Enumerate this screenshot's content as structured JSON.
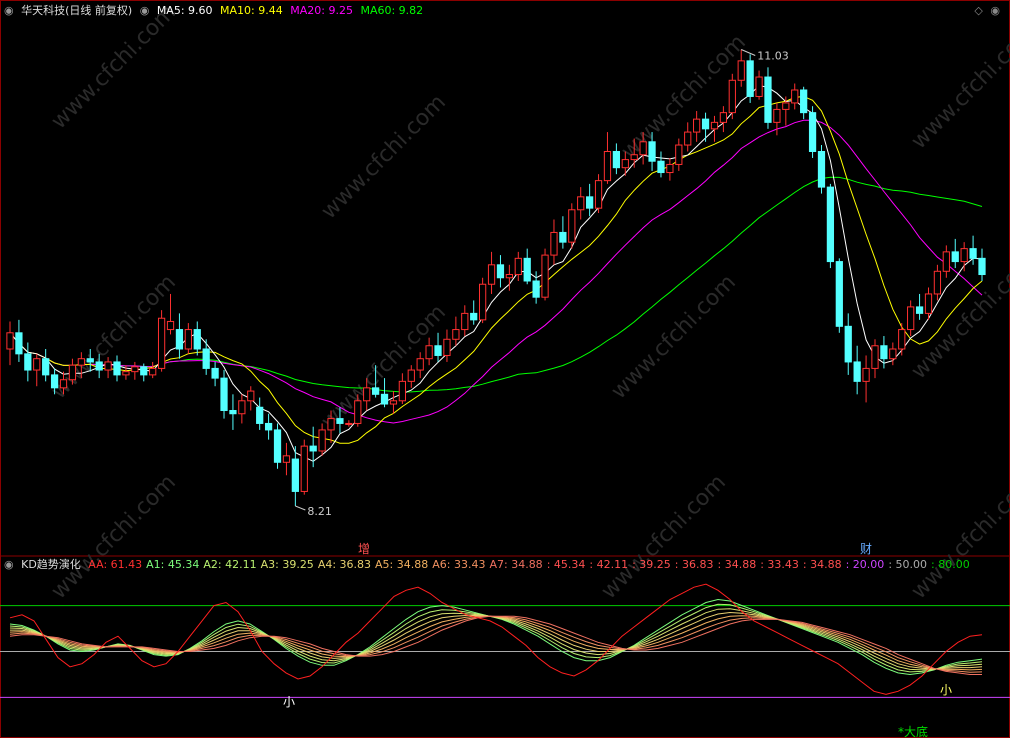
{
  "main_header": {
    "title": "华天科技(日线 前复权)",
    "items": [
      {
        "label": "MA5: 9.60",
        "color": "#ffffff"
      },
      {
        "label": "MA10: 9.44",
        "color": "#ffff00"
      },
      {
        "label": "MA20: 9.25",
        "color": "#ff00ff"
      },
      {
        "label": "MA60: 9.82",
        "color": "#00ff00"
      }
    ]
  },
  "kd_header": {
    "title": "KD趋势演化",
    "items": [
      {
        "label": "AA: 61.43",
        "color": "#ff3030"
      },
      {
        "label": "A1: 45.34",
        "color": "#7cfc7c"
      },
      {
        "label": "A2: 42.11",
        "color": "#b8f070"
      },
      {
        "label": "A3: 39.25",
        "color": "#d8e070"
      },
      {
        "label": "A4: 36.83",
        "color": "#e8d070"
      },
      {
        "label": "A5: 34.88",
        "color": "#f0b060"
      },
      {
        "label": "A6: 33.43",
        "color": "#f09060"
      },
      {
        "label": "A7: 34.88",
        "color": "#f07060"
      },
      {
        "label": ": 45.34",
        "color": "#ff5050"
      },
      {
        "label": ": 42.11",
        "color": "#ff5050"
      },
      {
        "label": ": 39.25",
        "color": "#ff5050"
      },
      {
        "label": ": 36.83",
        "color": "#ff5050"
      },
      {
        "label": ": 34.88",
        "color": "#ff5050"
      },
      {
        "label": ": 33.43",
        "color": "#ff5050"
      },
      {
        "label": ": 34.88",
        "color": "#ff5050"
      },
      {
        "label": ": 20.00",
        "color": "#cc44ff"
      },
      {
        "label": ": 50.00",
        "color": "#aaaaaa"
      },
      {
        "label": ": 80.00",
        "color": "#00cc00"
      }
    ]
  },
  "markers": {
    "high": "11.03",
    "low": "8.21",
    "event1": "增",
    "event2": "财",
    "small1": "小",
    "small2": "小",
    "bottom": "*大底"
  },
  "watermark": "www.cfchi.com",
  "colors": {
    "up": "#ff3030",
    "down": "#54ffff",
    "ma5": "#ffffff",
    "ma10": "#ffff00",
    "ma20": "#ff00ff",
    "ma60": "#00ff00"
  },
  "chart_data": {
    "type": "candlestick",
    "price_range": [
      8.0,
      11.2
    ],
    "candles": [
      {
        "o": 9.18,
        "h": 9.35,
        "l": 9.08,
        "c": 9.28
      },
      {
        "o": 9.28,
        "h": 9.36,
        "l": 9.1,
        "c": 9.15
      },
      {
        "o": 9.15,
        "h": 9.22,
        "l": 8.98,
        "c": 9.05
      },
      {
        "o": 9.05,
        "h": 9.15,
        "l": 8.95,
        "c": 9.12
      },
      {
        "o": 9.12,
        "h": 9.18,
        "l": 8.98,
        "c": 9.02
      },
      {
        "o": 9.02,
        "h": 9.06,
        "l": 8.9,
        "c": 8.94
      },
      {
        "o": 8.94,
        "h": 9.04,
        "l": 8.9,
        "c": 8.99
      },
      {
        "o": 8.99,
        "h": 9.12,
        "l": 8.96,
        "c": 9.08
      },
      {
        "o": 9.08,
        "h": 9.16,
        "l": 9.0,
        "c": 9.12
      },
      {
        "o": 9.12,
        "h": 9.18,
        "l": 9.04,
        "c": 9.1
      },
      {
        "o": 9.1,
        "h": 9.15,
        "l": 9.0,
        "c": 9.05
      },
      {
        "o": 9.05,
        "h": 9.13,
        "l": 9.0,
        "c": 9.1
      },
      {
        "o": 9.1,
        "h": 9.14,
        "l": 8.98,
        "c": 9.02
      },
      {
        "o": 9.02,
        "h": 9.08,
        "l": 8.99,
        "c": 9.04
      },
      {
        "o": 9.04,
        "h": 9.1,
        "l": 8.99,
        "c": 9.07
      },
      {
        "o": 9.07,
        "h": 9.09,
        "l": 8.98,
        "c": 9.02
      },
      {
        "o": 9.02,
        "h": 9.1,
        "l": 9.0,
        "c": 9.06
      },
      {
        "o": 9.06,
        "h": 9.42,
        "l": 9.04,
        "c": 9.37
      },
      {
        "o": 9.3,
        "h": 9.52,
        "l": 9.27,
        "c": 9.35
      },
      {
        "o": 9.3,
        "h": 9.4,
        "l": 9.12,
        "c": 9.18
      },
      {
        "o": 9.18,
        "h": 9.34,
        "l": 9.15,
        "c": 9.3
      },
      {
        "o": 9.3,
        "h": 9.35,
        "l": 9.14,
        "c": 9.18
      },
      {
        "o": 9.18,
        "h": 9.24,
        "l": 9.02,
        "c": 9.06
      },
      {
        "o": 9.06,
        "h": 9.1,
        "l": 8.95,
        "c": 9.0
      },
      {
        "o": 9.0,
        "h": 9.05,
        "l": 8.75,
        "c": 8.8
      },
      {
        "o": 8.8,
        "h": 8.9,
        "l": 8.68,
        "c": 8.78
      },
      {
        "o": 8.78,
        "h": 8.9,
        "l": 8.72,
        "c": 8.86
      },
      {
        "o": 8.86,
        "h": 8.95,
        "l": 8.8,
        "c": 8.92
      },
      {
        "o": 8.82,
        "h": 8.88,
        "l": 8.68,
        "c": 8.72
      },
      {
        "o": 8.72,
        "h": 8.78,
        "l": 8.62,
        "c": 8.68
      },
      {
        "o": 8.68,
        "h": 8.72,
        "l": 8.44,
        "c": 8.48
      },
      {
        "o": 8.48,
        "h": 8.6,
        "l": 8.4,
        "c": 8.52
      },
      {
        "o": 8.5,
        "h": 8.58,
        "l": 8.21,
        "c": 8.3
      },
      {
        "o": 8.3,
        "h": 8.62,
        "l": 8.28,
        "c": 8.58
      },
      {
        "o": 8.58,
        "h": 8.7,
        "l": 8.45,
        "c": 8.55
      },
      {
        "o": 8.55,
        "h": 8.72,
        "l": 8.52,
        "c": 8.68
      },
      {
        "o": 8.68,
        "h": 8.8,
        "l": 8.6,
        "c": 8.75
      },
      {
        "o": 8.75,
        "h": 8.82,
        "l": 8.66,
        "c": 8.72
      },
      {
        "o": 8.72,
        "h": 8.74,
        "l": 8.7,
        "c": 8.72
      },
      {
        "o": 8.72,
        "h": 8.9,
        "l": 8.7,
        "c": 8.86
      },
      {
        "o": 8.86,
        "h": 9.0,
        "l": 8.8,
        "c": 8.94
      },
      {
        "o": 8.94,
        "h": 9.08,
        "l": 8.88,
        "c": 8.9
      },
      {
        "o": 8.9,
        "h": 9.0,
        "l": 8.82,
        "c": 8.84
      },
      {
        "o": 8.84,
        "h": 8.92,
        "l": 8.78,
        "c": 8.86
      },
      {
        "o": 8.86,
        "h": 9.03,
        "l": 8.84,
        "c": 8.98
      },
      {
        "o": 8.98,
        "h": 9.08,
        "l": 8.94,
        "c": 9.05
      },
      {
        "o": 9.05,
        "h": 9.16,
        "l": 9.0,
        "c": 9.12
      },
      {
        "o": 9.12,
        "h": 9.25,
        "l": 9.08,
        "c": 9.2
      },
      {
        "o": 9.2,
        "h": 9.28,
        "l": 9.1,
        "c": 9.14
      },
      {
        "o": 9.14,
        "h": 9.3,
        "l": 9.1,
        "c": 9.24
      },
      {
        "o": 9.24,
        "h": 9.38,
        "l": 9.2,
        "c": 9.3
      },
      {
        "o": 9.3,
        "h": 9.45,
        "l": 9.26,
        "c": 9.4
      },
      {
        "o": 9.4,
        "h": 9.48,
        "l": 9.33,
        "c": 9.36
      },
      {
        "o": 9.36,
        "h": 9.62,
        "l": 9.34,
        "c": 9.58
      },
      {
        "o": 9.58,
        "h": 9.78,
        "l": 9.52,
        "c": 9.7
      },
      {
        "o": 9.7,
        "h": 9.76,
        "l": 9.56,
        "c": 9.62
      },
      {
        "o": 9.62,
        "h": 9.7,
        "l": 9.54,
        "c": 9.64
      },
      {
        "o": 9.64,
        "h": 9.78,
        "l": 9.6,
        "c": 9.74
      },
      {
        "o": 9.74,
        "h": 9.8,
        "l": 9.58,
        "c": 9.6
      },
      {
        "o": 9.6,
        "h": 9.66,
        "l": 9.46,
        "c": 9.5
      },
      {
        "o": 9.5,
        "h": 9.8,
        "l": 9.48,
        "c": 9.76
      },
      {
        "o": 9.76,
        "h": 9.98,
        "l": 9.7,
        "c": 9.9
      },
      {
        "o": 9.9,
        "h": 10.0,
        "l": 9.8,
        "c": 9.84
      },
      {
        "o": 9.84,
        "h": 10.08,
        "l": 9.8,
        "c": 10.04
      },
      {
        "o": 10.04,
        "h": 10.18,
        "l": 9.98,
        "c": 10.12
      },
      {
        "o": 10.12,
        "h": 10.2,
        "l": 10.0,
        "c": 10.05
      },
      {
        "o": 10.05,
        "h": 10.26,
        "l": 10.02,
        "c": 10.22
      },
      {
        "o": 10.22,
        "h": 10.52,
        "l": 10.2,
        "c": 10.4
      },
      {
        "o": 10.4,
        "h": 10.45,
        "l": 10.26,
        "c": 10.3
      },
      {
        "o": 10.3,
        "h": 10.4,
        "l": 10.25,
        "c": 10.35
      },
      {
        "o": 10.35,
        "h": 10.48,
        "l": 10.3,
        "c": 10.38
      },
      {
        "o": 10.38,
        "h": 10.52,
        "l": 10.32,
        "c": 10.46
      },
      {
        "o": 10.46,
        "h": 10.52,
        "l": 10.28,
        "c": 10.34
      },
      {
        "o": 10.34,
        "h": 10.4,
        "l": 10.24,
        "c": 10.27
      },
      {
        "o": 10.27,
        "h": 10.36,
        "l": 10.22,
        "c": 10.32
      },
      {
        "o": 10.32,
        "h": 10.48,
        "l": 10.28,
        "c": 10.44
      },
      {
        "o": 10.44,
        "h": 10.58,
        "l": 10.4,
        "c": 10.52
      },
      {
        "o": 10.52,
        "h": 10.65,
        "l": 10.46,
        "c": 10.6
      },
      {
        "o": 10.6,
        "h": 10.64,
        "l": 10.46,
        "c": 10.54
      },
      {
        "o": 10.54,
        "h": 10.62,
        "l": 10.46,
        "c": 10.58
      },
      {
        "o": 10.58,
        "h": 10.68,
        "l": 10.52,
        "c": 10.64
      },
      {
        "o": 10.64,
        "h": 10.88,
        "l": 10.6,
        "c": 10.84
      },
      {
        "o": 10.84,
        "h": 11.03,
        "l": 10.8,
        "c": 10.96
      },
      {
        "o": 10.96,
        "h": 11.0,
        "l": 10.7,
        "c": 10.74
      },
      {
        "o": 10.74,
        "h": 10.9,
        "l": 10.72,
        "c": 10.86
      },
      {
        "o": 10.86,
        "h": 10.92,
        "l": 10.54,
        "c": 10.58
      },
      {
        "o": 10.58,
        "h": 10.7,
        "l": 10.5,
        "c": 10.66
      },
      {
        "o": 10.66,
        "h": 10.74,
        "l": 10.56,
        "c": 10.7
      },
      {
        "o": 10.7,
        "h": 10.82,
        "l": 10.66,
        "c": 10.78
      },
      {
        "o": 10.78,
        "h": 10.8,
        "l": 10.6,
        "c": 10.64
      },
      {
        "o": 10.64,
        "h": 10.68,
        "l": 10.36,
        "c": 10.4
      },
      {
        "o": 10.4,
        "h": 10.44,
        "l": 10.14,
        "c": 10.18
      },
      {
        "o": 10.18,
        "h": 10.2,
        "l": 9.68,
        "c": 9.72
      },
      {
        "o": 9.72,
        "h": 9.74,
        "l": 9.28,
        "c": 9.32
      },
      {
        "o": 9.32,
        "h": 9.4,
        "l": 9.02,
        "c": 9.1
      },
      {
        "o": 9.1,
        "h": 9.2,
        "l": 8.9,
        "c": 8.98
      },
      {
        "o": 8.98,
        "h": 9.14,
        "l": 8.85,
        "c": 9.06
      },
      {
        "o": 9.06,
        "h": 9.24,
        "l": 9.0,
        "c": 9.2
      },
      {
        "o": 9.2,
        "h": 9.26,
        "l": 9.06,
        "c": 9.12
      },
      {
        "o": 9.12,
        "h": 9.22,
        "l": 9.08,
        "c": 9.18
      },
      {
        "o": 9.18,
        "h": 9.34,
        "l": 9.14,
        "c": 9.3
      },
      {
        "o": 9.3,
        "h": 9.48,
        "l": 9.26,
        "c": 9.44
      },
      {
        "o": 9.44,
        "h": 9.52,
        "l": 9.36,
        "c": 9.4
      },
      {
        "o": 9.4,
        "h": 9.56,
        "l": 9.36,
        "c": 9.52
      },
      {
        "o": 9.52,
        "h": 9.7,
        "l": 9.48,
        "c": 9.66
      },
      {
        "o": 9.66,
        "h": 9.82,
        "l": 9.62,
        "c": 9.78
      },
      {
        "o": 9.78,
        "h": 9.86,
        "l": 9.68,
        "c": 9.72
      },
      {
        "o": 9.72,
        "h": 9.84,
        "l": 9.66,
        "c": 9.8
      },
      {
        "o": 9.8,
        "h": 9.88,
        "l": 9.7,
        "c": 9.74
      },
      {
        "o": 9.74,
        "h": 9.8,
        "l": 9.6,
        "c": 9.64
      }
    ],
    "kd": {
      "AA": [
        72,
        74,
        70,
        58,
        46,
        40,
        42,
        48,
        56,
        60,
        52,
        44,
        40,
        42,
        50,
        60,
        70,
        80,
        82,
        76,
        64,
        50,
        42,
        36,
        32,
        34,
        40,
        48,
        56,
        62,
        70,
        78,
        86,
        90,
        92,
        88,
        82,
        78,
        74,
        72,
        70,
        66,
        60,
        54,
        46,
        40,
        36,
        34,
        38,
        44,
        52,
        60,
        66,
        72,
        78,
        84,
        88,
        92,
        94,
        90,
        84,
        76,
        70,
        66,
        62,
        58,
        54,
        50,
        46,
        42,
        36,
        30,
        24,
        22,
        24,
        28,
        34,
        42,
        50,
        56,
        60,
        61
      ],
      "A1": [
        68,
        67,
        64,
        60,
        55,
        51,
        50,
        51,
        53,
        55,
        54,
        51,
        48,
        47,
        48,
        52,
        57,
        63,
        68,
        70,
        68,
        63,
        58,
        52,
        47,
        43,
        41,
        41,
        44,
        48,
        53,
        59,
        65,
        71,
        76,
        79,
        80,
        79,
        77,
        75,
        73,
        71,
        68,
        64,
        60,
        55,
        50,
        46,
        44,
        44,
        46,
        50,
        54,
        59,
        64,
        69,
        74,
        78,
        82,
        84,
        83,
        80,
        77,
        74,
        71,
        68,
        65,
        62,
        59,
        56,
        52,
        48,
        43,
        39,
        36,
        35,
        36,
        38,
        41,
        43,
        44,
        45
      ],
      "A7": [
        60,
        61,
        61,
        60,
        59,
        57,
        55,
        54,
        53,
        53,
        53,
        53,
        52,
        51,
        50,
        50,
        51,
        52,
        54,
        57,
        59,
        60,
        60,
        59,
        57,
        55,
        52,
        50,
        48,
        47,
        47,
        48,
        50,
        53,
        56,
        60,
        64,
        67,
        70,
        72,
        73,
        73,
        73,
        72,
        70,
        68,
        65,
        62,
        59,
        56,
        54,
        52,
        51,
        51,
        52,
        54,
        56,
        59,
        62,
        65,
        68,
        70,
        71,
        71,
        71,
        70,
        69,
        67,
        65,
        63,
        61,
        58,
        55,
        52,
        48,
        45,
        42,
        39,
        37,
        36,
        35,
        35
      ]
    },
    "kd_levels": [
      20,
      50,
      80
    ]
  }
}
